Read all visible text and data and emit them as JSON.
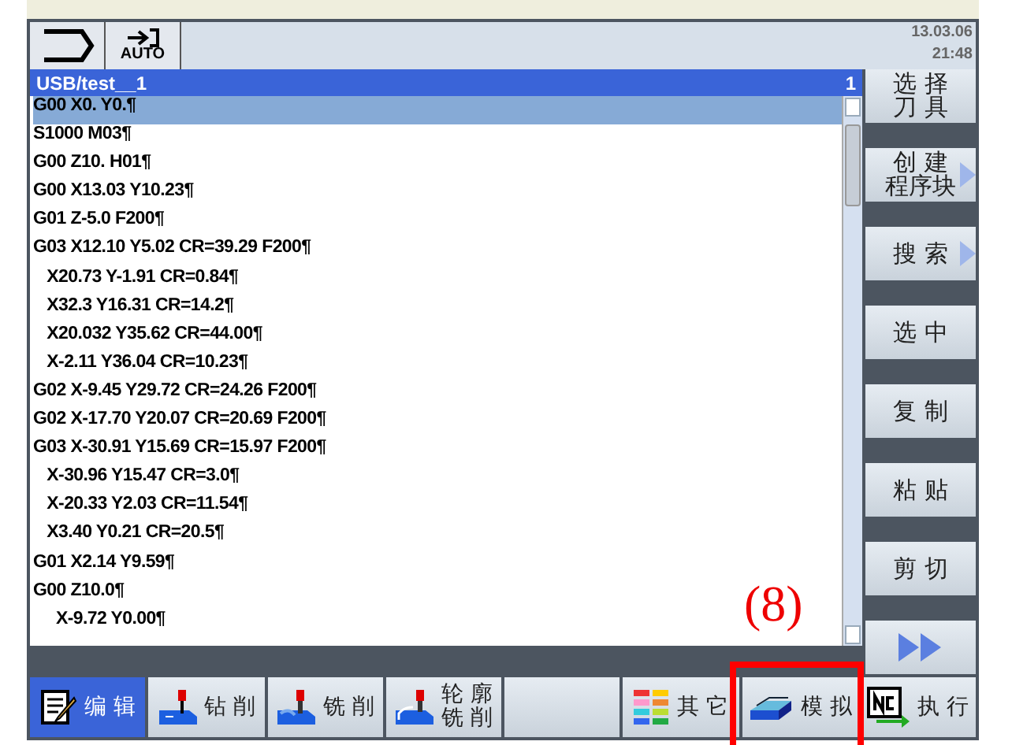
{
  "header": {
    "mode": "AUTO",
    "date": "13.03.06",
    "time": "21:48"
  },
  "editor": {
    "path": "USB/test__1",
    "channel": "1",
    "lines": [
      {
        "text": "G00 X0. Y0.¶",
        "selected": true
      },
      {
        "text": "S1000 M03¶",
        "selected": false
      },
      {
        "text": "G00 Z10. H01¶",
        "selected": false
      },
      {
        "text": "G00 X13.03 Y10.23¶",
        "selected": false
      },
      {
        "text": "G01 Z-5.0 F200¶",
        "selected": false
      },
      {
        "text": "G03 X12.10 Y5.02 CR=39.29 F200¶",
        "selected": false
      },
      {
        "text": "   X20.73 Y-1.91 CR=0.84¶",
        "selected": false
      },
      {
        "text": "   X32.3 Y16.31 CR=14.2¶",
        "selected": false
      },
      {
        "text": "   X20.032 Y35.62 CR=44.00¶",
        "selected": false
      },
      {
        "text": "   X-2.11 Y36.04 CR=10.23¶",
        "selected": false
      },
      {
        "text": "G02 X-9.45 Y29.72 CR=24.26 F200¶",
        "selected": false
      },
      {
        "text": "G02 X-17.70 Y20.07 CR=20.69 F200¶",
        "selected": false
      },
      {
        "text": "G03 X-30.91 Y15.69 CR=15.97 F200¶",
        "selected": false
      },
      {
        "text": "   X-30.96 Y15.47 CR=3.0¶",
        "selected": false
      },
      {
        "text": "   X-20.33 Y2.03 CR=11.54¶",
        "selected": false
      },
      {
        "text": "   X3.40 Y0.21 CR=20.5¶",
        "selected": false
      },
      {
        "text": "G01 X2.14 Y9.59¶",
        "selected": false
      },
      {
        "text": "G00 Z10.0¶",
        "selected": false
      },
      {
        "text": "     X-9.72 Y0.00¶",
        "selected": false
      }
    ]
  },
  "softkeys": [
    {
      "kind": "text",
      "lines": [
        "选 择",
        "刀 具"
      ],
      "has_arrow": false
    },
    {
      "kind": "text",
      "lines": [
        "创 建",
        "程序块"
      ],
      "has_arrow": true
    },
    {
      "kind": "text",
      "lines": [
        "搜 索"
      ],
      "has_arrow": true
    },
    {
      "kind": "text",
      "lines": [
        "选 中"
      ],
      "has_arrow": false
    },
    {
      "kind": "text",
      "lines": [
        "复 制"
      ],
      "has_arrow": false
    },
    {
      "kind": "text",
      "lines": [
        "粘 贴"
      ],
      "has_arrow": false
    },
    {
      "kind": "text",
      "lines": [
        "剪 切"
      ],
      "has_arrow": false
    },
    {
      "kind": "more",
      "has_arrow": false
    }
  ],
  "tabs": [
    {
      "kind": "edit",
      "lines": [
        "编 辑"
      ],
      "selected": true,
      "highlighted": false
    },
    {
      "kind": "drill",
      "lines": [
        "钻 削"
      ],
      "selected": false,
      "highlighted": false
    },
    {
      "kind": "mill",
      "lines": [
        "铣 削"
      ],
      "selected": false,
      "highlighted": false
    },
    {
      "kind": "contour",
      "lines": [
        "轮 廓",
        "铣 削"
      ],
      "selected": false,
      "highlighted": false
    },
    {
      "kind": "blank",
      "selected": false,
      "highlighted": false
    },
    {
      "kind": "other",
      "lines": [
        "其 它"
      ],
      "selected": false,
      "highlighted": false
    },
    {
      "kind": "simulate",
      "lines": [
        "模 拟"
      ],
      "selected": false,
      "highlighted": true
    },
    {
      "kind": "run",
      "lines": [
        "执 行"
      ],
      "selected": false,
      "highlighted": false
    }
  ],
  "annotation": {
    "label": "(8)"
  }
}
